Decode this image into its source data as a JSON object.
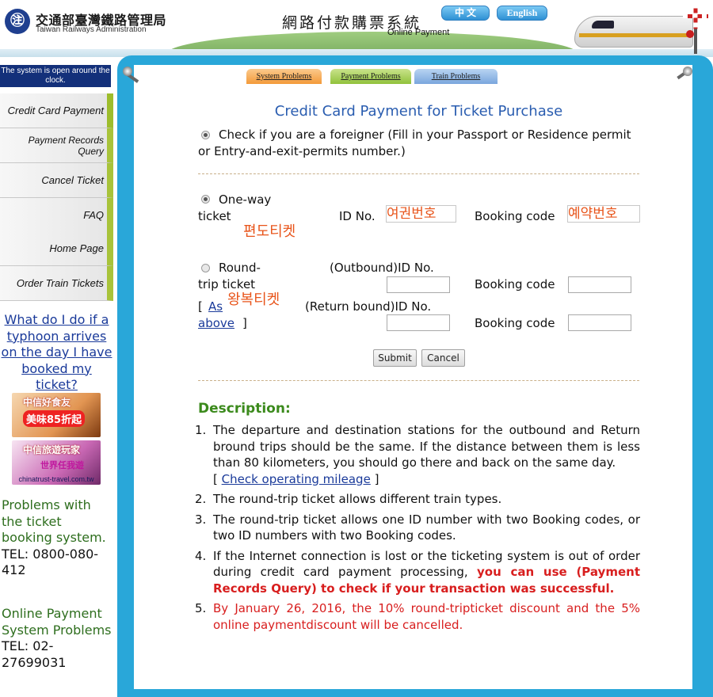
{
  "header": {
    "logo_glyph": "㊟",
    "agency_cn": "交通部臺灣鐵路管理局",
    "agency_en": "Taiwan Railways Administration",
    "system_cn": "網路付款購票系統",
    "system_en": "Online Payment",
    "lang_zh": "中 文",
    "lang_en": "English"
  },
  "sidebar": {
    "notice": "The system is open around the clock.",
    "nav": [
      "Credit Card Payment",
      "Payment Records Query",
      "Cancel Ticket",
      "FAQ",
      "Home Page",
      "Order Train Tickets"
    ],
    "typhoon_link": "What do I do if a typhoon arrives on the day I have booked my ticket?",
    "ad1": {
      "title": "中信好食友",
      "sub": "美味85折起"
    },
    "ad2": {
      "title": "中信旅遊玩家",
      "sub": "世界任我遊",
      "url": "chinatrust-travel.com.tw"
    },
    "problems_ticket": "Problems with the ticket booking system.",
    "problems_ticket_tel": "TEL: 0800-080-412",
    "problems_payment": "Online Payment System Problems",
    "problems_payment_tel": "TEL: 02-27699031"
  },
  "tabs": [
    "System Problems",
    "Payment Problems",
    "Train Problems"
  ],
  "form": {
    "title": "Credit Card Payment for Ticket Purchase",
    "foreigner_label": "Check if you are a foreigner (Fill in your Passport or Residence permit or Entry-and-exit-permits number.)",
    "oneway_label": "One-way ticket",
    "id_no_label": "ID No.",
    "booking_code_label": "Booking code",
    "oneway_id_annotation": "여권번호",
    "oneway_bc_annotation": "예약번호",
    "oneway_note": "편도티켓",
    "round_label": "Round-trip ticket",
    "outbound_id_label": "(Outbound)ID No.",
    "return_id_label": "(Return bound)ID No.",
    "bracket_open": "[",
    "bracket_close": "]",
    "as_above": "As above",
    "round_note": "왕복티켓",
    "outbound_id_value": "",
    "outbound_bc_value": "",
    "return_id_value": "",
    "return_bc_value": "",
    "submit": "Submit",
    "cancel": "Cancel"
  },
  "description": {
    "title": "Description:",
    "item1_num": "1.",
    "item1": "The departure and destination stations for the outbound and Return bround trips should be the same. If the distance between them is less than 80 kilometers, you should go there and back on the same day.",
    "item1_link_open": "[",
    "item1_link": "Check operating mileage",
    "item1_link_close": "]",
    "item2_num": "2.",
    "item2": "The round-trip ticket allows different train types.",
    "item3_num": "3.",
    "item3": "The round-trip ticket allows one ID number with two Booking codes, or two ID numbers with two Booking codes.",
    "item4_num": "4.",
    "item4_a": "If the Internet connection is lost or the ticketing system is out of order during credit card payment processing,",
    "item4_b": "you can use (Payment Records Query) to check if your transaction was successful.",
    "item5_num": "5.",
    "item5": "By January 26, 2016, the 10% round-tripticket discount and the 5% online paymentdiscount will be cancelled."
  },
  "colors": {
    "nav_accent": "#a8c33a",
    "frame_blue": "#29a7d9",
    "title_blue": "#2a5db0",
    "desc_green": "#3b8a1c",
    "warning_red": "#d81e1e",
    "annotation_orange": "#e8541a"
  }
}
